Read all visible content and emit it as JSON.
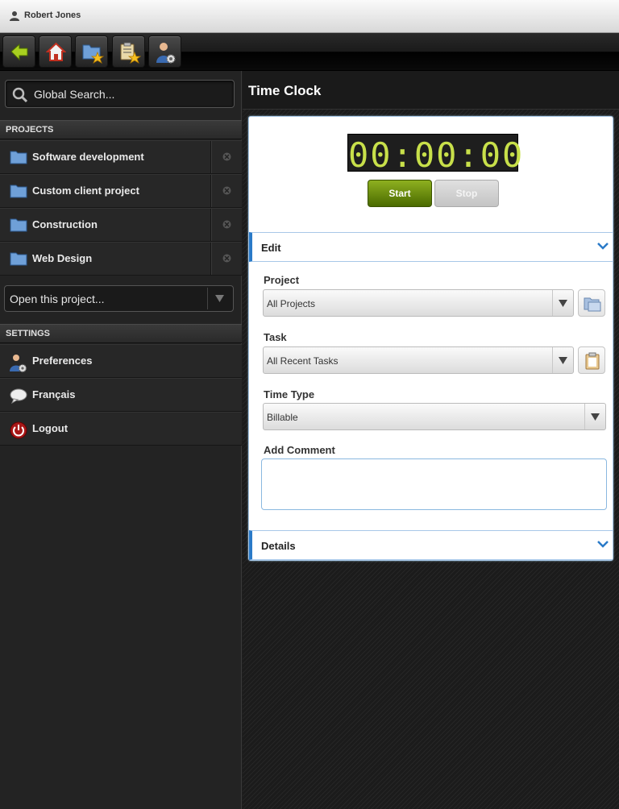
{
  "titlebar": {
    "user_name": "Robert Jones",
    "icon": "person-icon"
  },
  "toolbar": {
    "buttons": [
      {
        "name": "back",
        "icon": "back-arrow-icon"
      },
      {
        "name": "home",
        "icon": "home-icon"
      },
      {
        "name": "favorite-projects",
        "icon": "folder-star-icon"
      },
      {
        "name": "favorite-tasks",
        "icon": "clipboard-star-icon"
      },
      {
        "name": "user-settings",
        "icon": "user-gear-icon"
      }
    ]
  },
  "sidebar": {
    "search_placeholder": "Global Search...",
    "projects_header": "PROJECTS",
    "projects": [
      {
        "label": "Software development"
      },
      {
        "label": "Custom client project"
      },
      {
        "label": "Construction"
      },
      {
        "label": "Web Design"
      }
    ],
    "open_project": "Open this project...",
    "settings_header": "SETTINGS",
    "settings": [
      {
        "label": "Preferences",
        "icon": "user-gear-icon"
      },
      {
        "label": "Français",
        "icon": "speech-bubble-icon"
      },
      {
        "label": "Logout",
        "icon": "power-icon"
      }
    ]
  },
  "main": {
    "title": "Time Clock",
    "clock": "00:00:00",
    "start_label": "Start",
    "stop_label": "Stop",
    "edit_label": "Edit",
    "details_label": "Details",
    "project_label": "Project",
    "project_value": "All Projects",
    "task_label": "Task",
    "task_value": "All Recent Tasks",
    "time_type_label": "Time Type",
    "time_type_value": "Billable",
    "comment_label": "Add Comment",
    "comment_value": ""
  },
  "colors": {
    "accent": "#2a7ac8",
    "start_green": "#6a8e10",
    "clock_digits": "#c8e04a"
  }
}
